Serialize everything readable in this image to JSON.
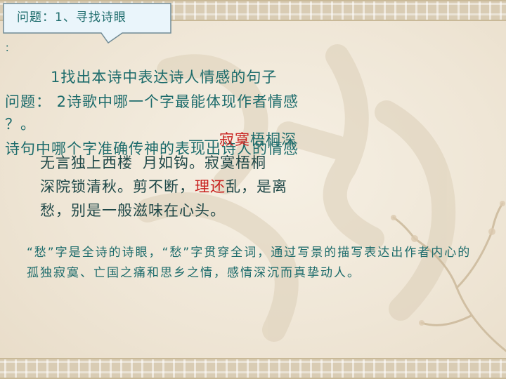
{
  "callout": {
    "text": "问题：1、寻找诗眼"
  },
  "stray_mark": "：",
  "lines": {
    "line1": {
      "prefix": "1",
      "text": "找出本诗中表达诗人情感的句子"
    },
    "line2": {
      "prefix": "问题： 2",
      "text": "诗歌中哪一个字最能体现作者情感"
    },
    "line3": "？。",
    "line4": "诗句中哪个字准确传神的表现出诗人的情感",
    "overlay": {
      "before": "——",
      "red": "寂寞",
      "after": "梧桐深"
    }
  },
  "poem": {
    "line1a": "无言独上西楼",
    "line1b": "月如钩。寂寞梧桐",
    "line2": {
      "before": "深院锁清秋。剪不断，",
      "red": "理还",
      "after": "乱，是离"
    },
    "line3": "愁，别是一般滋味在心头。"
  },
  "note": {
    "line1": "“愁”字是全诗的诗眼，“愁”字贯穿全词，通过写景的描写表达出作者内心的",
    "line2": "孤独寂寞、亡国之痛和思乡之情，感情深沉而真挚动人。"
  },
  "colors": {
    "teal": "#1c6b6b",
    "red": "#c8201e",
    "callout_bg": "#eaf5fb"
  }
}
